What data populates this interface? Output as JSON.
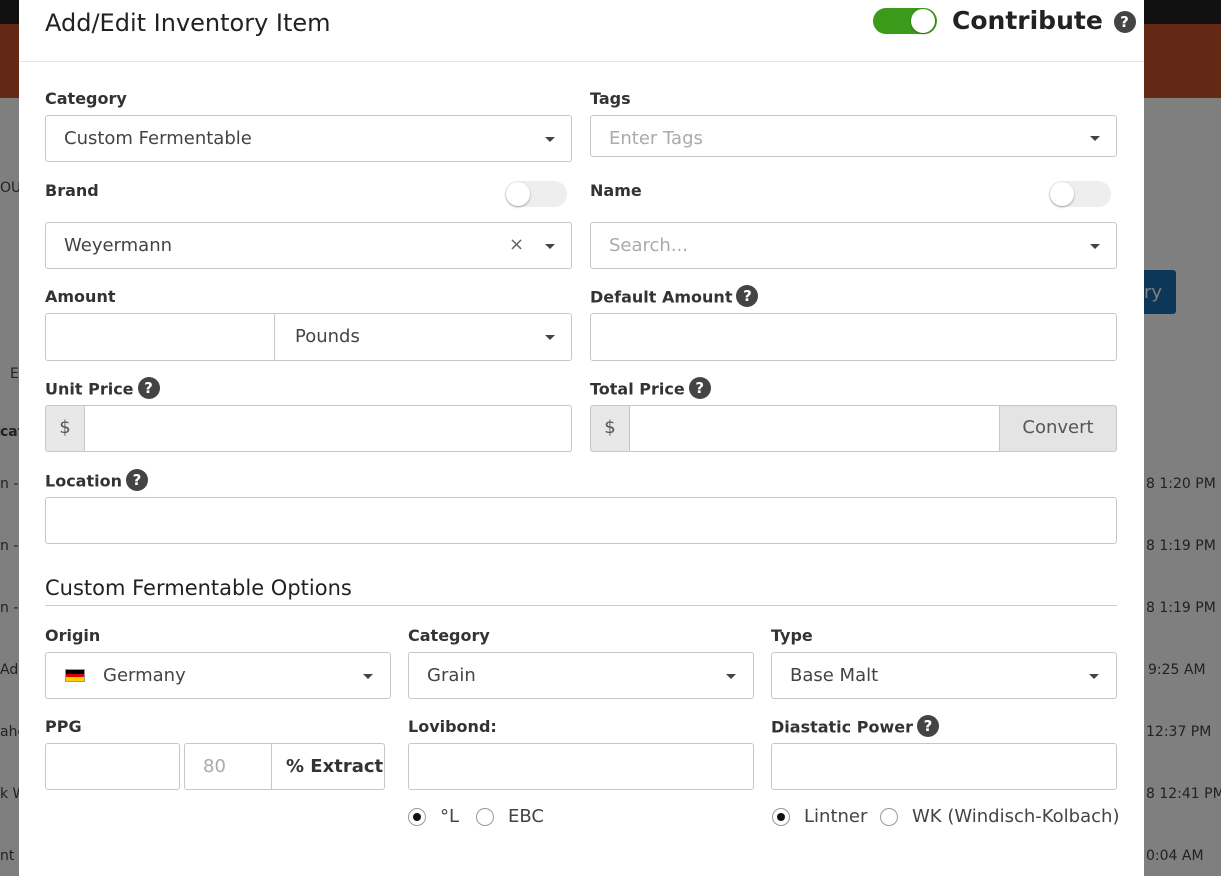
{
  "background": {
    "fragments": [
      "OU",
      "E",
      "cat",
      "n -",
      "n -",
      "n -",
      "Ad",
      "ahe",
      "k W",
      "nt N",
      "ry"
    ],
    "timestamps": [
      "8 1:20 PM",
      "8 1:19 PM",
      "8 1:19 PM",
      "9:25 AM",
      "12:37 PM",
      "8 12:41 PM",
      "0:04 AM"
    ]
  },
  "modal": {
    "title": "Add/Edit Inventory Item",
    "contribute_label": "Contribute",
    "contribute_on": true
  },
  "form": {
    "category": {
      "label": "Category",
      "value": "Custom Fermentable"
    },
    "tags": {
      "label": "Tags",
      "placeholder": "Enter Tags"
    },
    "brand": {
      "label": "Brand",
      "value": "Weyermann",
      "clear": "×"
    },
    "name": {
      "label": "Name",
      "placeholder": "Search..."
    },
    "amount": {
      "label": "Amount",
      "value": "",
      "unit": "Pounds"
    },
    "default_amount": {
      "label": "Default Amount",
      "value": ""
    },
    "unit_price": {
      "label": "Unit Price",
      "prefix": "$",
      "value": ""
    },
    "total_price": {
      "label": "Total Price",
      "prefix": "$",
      "value": "",
      "convert_label": "Convert"
    },
    "location": {
      "label": "Location",
      "value": ""
    }
  },
  "fermentable_options": {
    "title": "Custom Fermentable Options",
    "origin": {
      "label": "Origin",
      "value": "Germany",
      "flag_colors": [
        "#000000",
        "#dd0000",
        "#ffce00"
      ]
    },
    "category": {
      "label": "Category",
      "value": "Grain"
    },
    "type": {
      "label": "Type",
      "value": "Base Malt"
    },
    "ppg": {
      "label": "PPG",
      "value": "",
      "extract_placeholder": "80",
      "extract_addon": "% Extract"
    },
    "lovibond": {
      "label": "Lovibond:",
      "value": "",
      "options": [
        "°L",
        "EBC"
      ],
      "selected": "°L"
    },
    "diastatic": {
      "label": "Diastatic Power",
      "value": "",
      "options": [
        "Lintner",
        "WK (Windisch-Kolbach)"
      ],
      "selected": "Lintner"
    }
  },
  "colors": {
    "toggle_on": "#3c9a1a",
    "topbar": "#c8522a",
    "button_blue": "#1a6fb3"
  }
}
